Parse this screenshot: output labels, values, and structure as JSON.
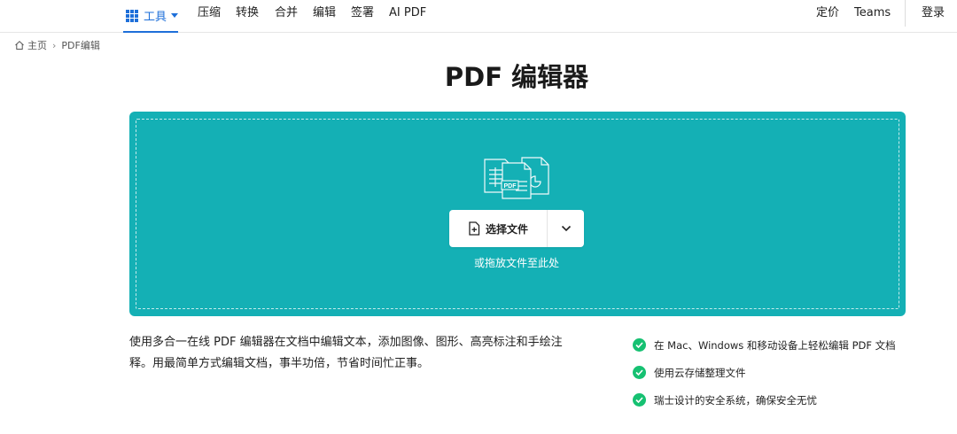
{
  "nav": {
    "tools_label": "工具",
    "items": [
      "压缩",
      "转换",
      "合并",
      "编辑",
      "签署",
      "AI PDF"
    ],
    "pricing": "定价",
    "teams": "Teams",
    "login": "登录"
  },
  "breadcrumb": {
    "home": "主页",
    "separator": "›",
    "current": "PDF编辑"
  },
  "page_title": "PDF 编辑器",
  "dropzone": {
    "select_label": "选择文件",
    "drop_hint": "或拖放文件至此处",
    "art_badge": "PDF"
  },
  "description": "使用多合一在线 PDF 编辑器在文档中编辑文本，添加图像、图形、高亮标注和手绘注释。用最简单方式编辑文档，事半功倍，节省时间忙正事。",
  "features": [
    "在 Mac、Windows 和移动设备上轻松编辑 PDF 文档",
    "使用云存储整理文件",
    "瑞士设计的安全系统，确保安全无忧"
  ],
  "colors": {
    "accent": "#1e6fd9",
    "dropzone": "#14b0b5",
    "check": "#16c172"
  }
}
